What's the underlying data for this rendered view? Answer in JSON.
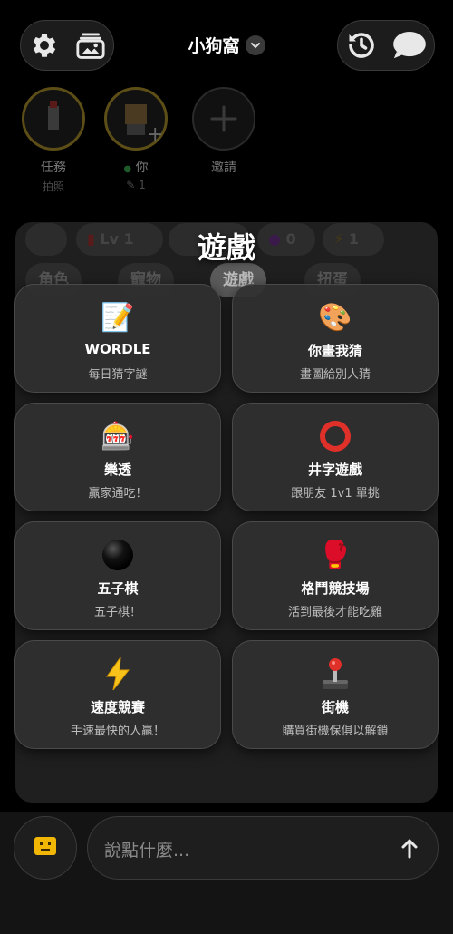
{
  "header": {
    "room_name": "小狗窩",
    "left_icons": [
      "gear-icon",
      "photo-album-icon"
    ],
    "right_icons": [
      "history-icon",
      "chat-bubble-icon"
    ]
  },
  "members": [
    {
      "name": "任務",
      "sub": "拍照"
    },
    {
      "name": "你",
      "sub": "1"
    },
    {
      "name": "邀請",
      "sub": ""
    }
  ],
  "background": {
    "level": "Lv 1",
    "counter": "0",
    "energy": "1",
    "tabs": [
      "角色",
      "寵物",
      "遊戲",
      "扭蛋"
    ]
  },
  "games_panel": {
    "title": "遊戲",
    "games": [
      {
        "icon": "📝",
        "name": "WORDLE",
        "desc": "每日猜字謎"
      },
      {
        "icon": "🎨",
        "name": "你畫我猜",
        "desc": "畫圖給別人猜"
      },
      {
        "icon": "🎰",
        "name": "樂透",
        "desc": "贏家通吃！"
      },
      {
        "icon": "⭕",
        "name": "井字遊戲",
        "desc": "跟朋友 1v1 單挑"
      },
      {
        "icon": "⚫",
        "name": "五子棋",
        "desc": "五子棋！"
      },
      {
        "icon": "🥊",
        "name": "格鬥競技場",
        "desc": "活到最後才能吃雞"
      },
      {
        "icon": "⚡",
        "name": "速度競賽",
        "desc": "手速最快的人贏！"
      },
      {
        "icon": "🕹️",
        "name": "街機",
        "desc": "購買街機保俱以解鎖"
      }
    ]
  },
  "composer": {
    "placeholder": "說點什麼...",
    "sticker_icon": "sticker-icon",
    "send_icon": "send-arrow-icon"
  }
}
